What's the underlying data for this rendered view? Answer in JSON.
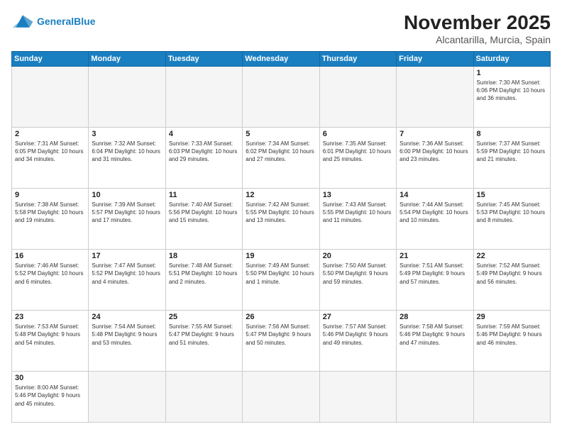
{
  "header": {
    "logo_general": "General",
    "logo_blue": "Blue",
    "month_title": "November 2025",
    "location": "Alcantarilla, Murcia, Spain"
  },
  "weekdays": [
    "Sunday",
    "Monday",
    "Tuesday",
    "Wednesday",
    "Thursday",
    "Friday",
    "Saturday"
  ],
  "weeks": [
    [
      {
        "day": "",
        "info": ""
      },
      {
        "day": "",
        "info": ""
      },
      {
        "day": "",
        "info": ""
      },
      {
        "day": "",
        "info": ""
      },
      {
        "day": "",
        "info": ""
      },
      {
        "day": "",
        "info": ""
      },
      {
        "day": "1",
        "info": "Sunrise: 7:30 AM\nSunset: 6:06 PM\nDaylight: 10 hours\nand 36 minutes."
      }
    ],
    [
      {
        "day": "2",
        "info": "Sunrise: 7:31 AM\nSunset: 6:05 PM\nDaylight: 10 hours\nand 34 minutes."
      },
      {
        "day": "3",
        "info": "Sunrise: 7:32 AM\nSunset: 6:04 PM\nDaylight: 10 hours\nand 31 minutes."
      },
      {
        "day": "4",
        "info": "Sunrise: 7:33 AM\nSunset: 6:03 PM\nDaylight: 10 hours\nand 29 minutes."
      },
      {
        "day": "5",
        "info": "Sunrise: 7:34 AM\nSunset: 6:02 PM\nDaylight: 10 hours\nand 27 minutes."
      },
      {
        "day": "6",
        "info": "Sunrise: 7:35 AM\nSunset: 6:01 PM\nDaylight: 10 hours\nand 25 minutes."
      },
      {
        "day": "7",
        "info": "Sunrise: 7:36 AM\nSunset: 6:00 PM\nDaylight: 10 hours\nand 23 minutes."
      },
      {
        "day": "8",
        "info": "Sunrise: 7:37 AM\nSunset: 5:59 PM\nDaylight: 10 hours\nand 21 minutes."
      }
    ],
    [
      {
        "day": "9",
        "info": "Sunrise: 7:38 AM\nSunset: 5:58 PM\nDaylight: 10 hours\nand 19 minutes."
      },
      {
        "day": "10",
        "info": "Sunrise: 7:39 AM\nSunset: 5:57 PM\nDaylight: 10 hours\nand 17 minutes."
      },
      {
        "day": "11",
        "info": "Sunrise: 7:40 AM\nSunset: 5:56 PM\nDaylight: 10 hours\nand 15 minutes."
      },
      {
        "day": "12",
        "info": "Sunrise: 7:42 AM\nSunset: 5:55 PM\nDaylight: 10 hours\nand 13 minutes."
      },
      {
        "day": "13",
        "info": "Sunrise: 7:43 AM\nSunset: 5:55 PM\nDaylight: 10 hours\nand 11 minutes."
      },
      {
        "day": "14",
        "info": "Sunrise: 7:44 AM\nSunset: 5:54 PM\nDaylight: 10 hours\nand 10 minutes."
      },
      {
        "day": "15",
        "info": "Sunrise: 7:45 AM\nSunset: 5:53 PM\nDaylight: 10 hours\nand 8 minutes."
      }
    ],
    [
      {
        "day": "16",
        "info": "Sunrise: 7:46 AM\nSunset: 5:52 PM\nDaylight: 10 hours\nand 6 minutes."
      },
      {
        "day": "17",
        "info": "Sunrise: 7:47 AM\nSunset: 5:52 PM\nDaylight: 10 hours\nand 4 minutes."
      },
      {
        "day": "18",
        "info": "Sunrise: 7:48 AM\nSunset: 5:51 PM\nDaylight: 10 hours\nand 2 minutes."
      },
      {
        "day": "19",
        "info": "Sunrise: 7:49 AM\nSunset: 5:50 PM\nDaylight: 10 hours\nand 1 minute."
      },
      {
        "day": "20",
        "info": "Sunrise: 7:50 AM\nSunset: 5:50 PM\nDaylight: 9 hours\nand 59 minutes."
      },
      {
        "day": "21",
        "info": "Sunrise: 7:51 AM\nSunset: 5:49 PM\nDaylight: 9 hours\nand 57 minutes."
      },
      {
        "day": "22",
        "info": "Sunrise: 7:52 AM\nSunset: 5:49 PM\nDaylight: 9 hours\nand 56 minutes."
      }
    ],
    [
      {
        "day": "23",
        "info": "Sunrise: 7:53 AM\nSunset: 5:48 PM\nDaylight: 9 hours\nand 54 minutes."
      },
      {
        "day": "24",
        "info": "Sunrise: 7:54 AM\nSunset: 5:48 PM\nDaylight: 9 hours\nand 53 minutes."
      },
      {
        "day": "25",
        "info": "Sunrise: 7:55 AM\nSunset: 5:47 PM\nDaylight: 9 hours\nand 51 minutes."
      },
      {
        "day": "26",
        "info": "Sunrise: 7:56 AM\nSunset: 5:47 PM\nDaylight: 9 hours\nand 50 minutes."
      },
      {
        "day": "27",
        "info": "Sunrise: 7:57 AM\nSunset: 5:46 PM\nDaylight: 9 hours\nand 49 minutes."
      },
      {
        "day": "28",
        "info": "Sunrise: 7:58 AM\nSunset: 5:46 PM\nDaylight: 9 hours\nand 47 minutes."
      },
      {
        "day": "29",
        "info": "Sunrise: 7:59 AM\nSunset: 5:46 PM\nDaylight: 9 hours\nand 46 minutes."
      }
    ],
    [
      {
        "day": "30",
        "info": "Sunrise: 8:00 AM\nSunset: 5:46 PM\nDaylight: 9 hours\nand 45 minutes."
      },
      {
        "day": "",
        "info": ""
      },
      {
        "day": "",
        "info": ""
      },
      {
        "day": "",
        "info": ""
      },
      {
        "day": "",
        "info": ""
      },
      {
        "day": "",
        "info": ""
      },
      {
        "day": "",
        "info": ""
      }
    ]
  ]
}
